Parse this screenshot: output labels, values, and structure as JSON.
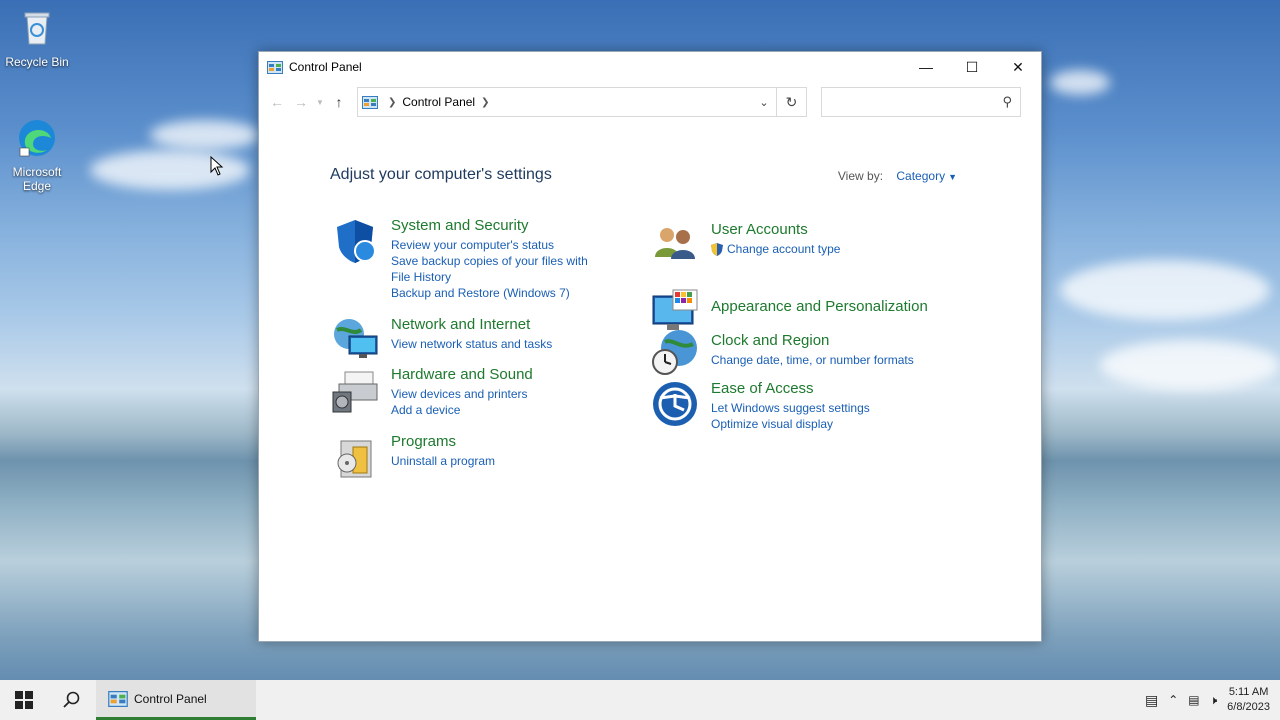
{
  "desktop": {
    "icons": [
      {
        "label": "Recycle Bin"
      },
      {
        "label": "Microsoft Edge"
      }
    ]
  },
  "window": {
    "title": "Control Panel",
    "breadcrumb": "Control Panel",
    "search_placeholder": ""
  },
  "content": {
    "heading": "Adjust your computer's settings",
    "view_by_label": "View by:",
    "view_by_value": "Category"
  },
  "categories": [
    {
      "title": "System and Security",
      "icon": "shield-icon",
      "links": [
        "Review your computer's status",
        "Save backup copies of your files with File History",
        "Backup and Restore (Windows 7)"
      ]
    },
    {
      "title": "Network and Internet",
      "icon": "network-icon",
      "links": [
        "View network status and tasks"
      ]
    },
    {
      "title": "Hardware and Sound",
      "icon": "printer-icon",
      "links": [
        "View devices and printers",
        "Add a device"
      ]
    },
    {
      "title": "Programs",
      "icon": "programs-icon",
      "links": [
        "Uninstall a program"
      ]
    },
    {
      "title": "User Accounts",
      "icon": "users-icon",
      "links": [
        "Change account type"
      ]
    },
    {
      "title": "Appearance and Personalization",
      "icon": "monitor-icon",
      "links": []
    },
    {
      "title": "Clock and Region",
      "icon": "clock-globe-icon",
      "links": [
        "Change date, time, or number formats"
      ]
    },
    {
      "title": "Ease of Access",
      "icon": "ease-of-access-icon",
      "links": [
        "Let Windows suggest settings",
        "Optimize visual display"
      ]
    }
  ],
  "taskbar": {
    "app_label": "Control Panel",
    "time": "5:11 AM",
    "date": "6/8/2023"
  },
  "colors": {
    "link": "#1a5fb4",
    "category_title": "#1e7a2e",
    "taskbar_active": "#2f7d32"
  }
}
